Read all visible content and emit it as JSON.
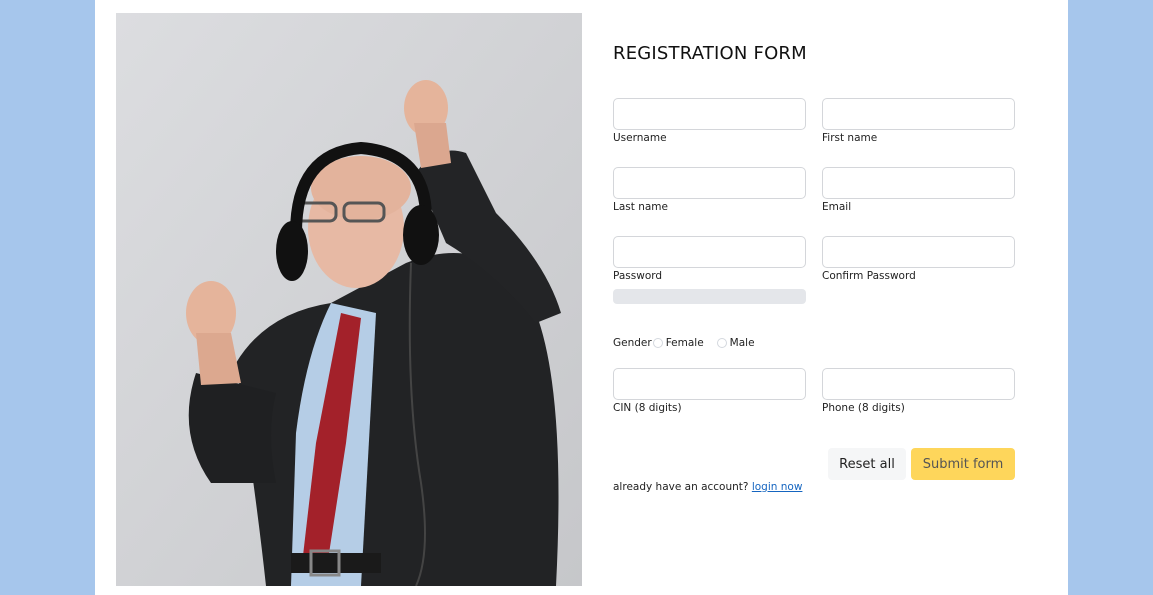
{
  "form": {
    "title": "REGISTRATION FORM",
    "fields": {
      "username": {
        "label": "Username",
        "value": ""
      },
      "first_name": {
        "label": "First name",
        "value": ""
      },
      "last_name": {
        "label": "Last name",
        "value": ""
      },
      "email": {
        "label": "Email",
        "value": ""
      },
      "password": {
        "label": "Password",
        "value": ""
      },
      "confirm_password": {
        "label": "Confirm Password",
        "value": ""
      },
      "cin": {
        "label": "CIN (8 digits)",
        "value": ""
      },
      "phone": {
        "label": "Phone (8 digits)",
        "value": ""
      }
    },
    "gender": {
      "label": "Gender",
      "options": [
        "Female",
        "Male"
      ],
      "selected": null
    },
    "buttons": {
      "reset": "Reset all",
      "submit": "Submit form"
    },
    "account": {
      "text": "already have an account?",
      "link": "login now"
    }
  },
  "colors": {
    "page_background": "#a6c6ec",
    "card_background": "#ffffff",
    "submit_button": "#fed65b",
    "reset_button": "#f5f6f7",
    "link": "#1565c0"
  },
  "image": {
    "subject": "elderly-man-with-headphones-dancing-photo"
  }
}
